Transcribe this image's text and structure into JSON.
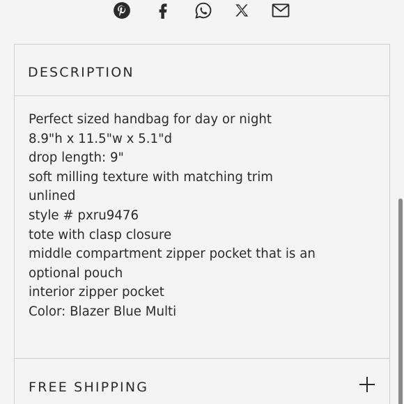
{
  "share": {
    "icons": [
      "pinterest-icon",
      "facebook-icon",
      "whatsapp-icon",
      "x-icon",
      "email-icon"
    ]
  },
  "description": {
    "title": "DESCRIPTION",
    "lines": [
      "Perfect sized handbag for day or night",
      "8.9\"h x 11.5\"w x 5.1\"d",
      "drop length: 9\"",
      "soft milling texture with matching trim",
      "unlined",
      "style # pxru9476",
      "tote with clasp closure",
      "middle compartment zipper pocket that is an",
      "optional pouch",
      "interior zipper pocket",
      "Color: Blazer Blue Multi"
    ]
  },
  "shipping": {
    "title": "FREE SHIPPING",
    "expand_icon": "plus-icon"
  },
  "colors": {
    "background": "#f4f4f4",
    "text": "#2b2b2b",
    "border": "#cfcfcf"
  }
}
